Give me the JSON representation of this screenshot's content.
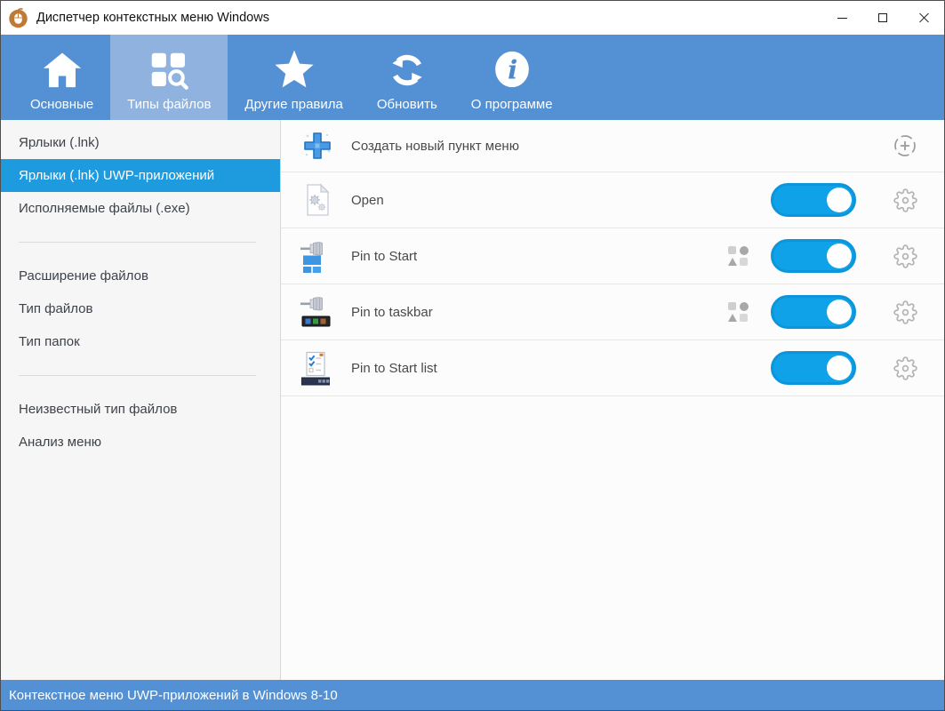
{
  "window": {
    "title": "Диспетчер контекстных меню Windows",
    "app_icon": "mouse-logo-icon",
    "controls": [
      "minimize",
      "maximize",
      "close"
    ]
  },
  "toolbar": {
    "tabs": [
      {
        "label": "Основные",
        "icon": "home-icon",
        "selected": false
      },
      {
        "label": "Типы файлов",
        "icon": "file-types-icon",
        "selected": true
      },
      {
        "label": "Другие правила",
        "icon": "star-icon",
        "selected": false
      },
      {
        "label": "Обновить",
        "icon": "refresh-icon",
        "selected": false
      },
      {
        "label": "О программе",
        "icon": "info-icon",
        "selected": false
      }
    ]
  },
  "sidebar": {
    "selected_item": "Ярлыки (.lnk) UWP-приложений",
    "groups": [
      {
        "items": [
          "Ярлыки (.lnk)",
          "Ярлыки (.lnk) UWP-приложений",
          "Исполняемые файлы (.exe)"
        ]
      },
      {
        "items": [
          "Расширение файлов",
          "Тип файлов",
          "Тип папок"
        ]
      },
      {
        "items": [
          "Неизвестный тип файлов",
          "Анализ меню"
        ]
      }
    ]
  },
  "main": {
    "new_item_label": "Создать новый пункт меню",
    "new_item_icon": "blue-plus-icon",
    "add_target_icon": "dashed-plus-circle-icon",
    "rows": [
      {
        "label": "Open",
        "icon": "document-gears-icon",
        "enabled": true,
        "has_uwp_badge": false
      },
      {
        "label": "Pin to Start",
        "icon": "pin-to-start-icon",
        "enabled": true,
        "has_uwp_badge": true
      },
      {
        "label": "Pin to taskbar",
        "icon": "pin-to-taskbar-icon",
        "enabled": true,
        "has_uwp_badge": true
      },
      {
        "label": "Pin to Start list",
        "icon": "pin-to-start-list-icon",
        "enabled": true,
        "has_uwp_badge": false
      }
    ]
  },
  "statusbar": {
    "text": "Контекстное меню UWP-приложений в Windows 8-10"
  },
  "colors": {
    "toolbar_blue": "#5390D4",
    "selected_tab": "#8FB2DF",
    "sidebar_selected_blue": "#1E9ADF",
    "toggle_on_fill": "#0FA2E8",
    "toggle_border": "#0C95DB",
    "statusbar_blue": "#5390D4"
  }
}
